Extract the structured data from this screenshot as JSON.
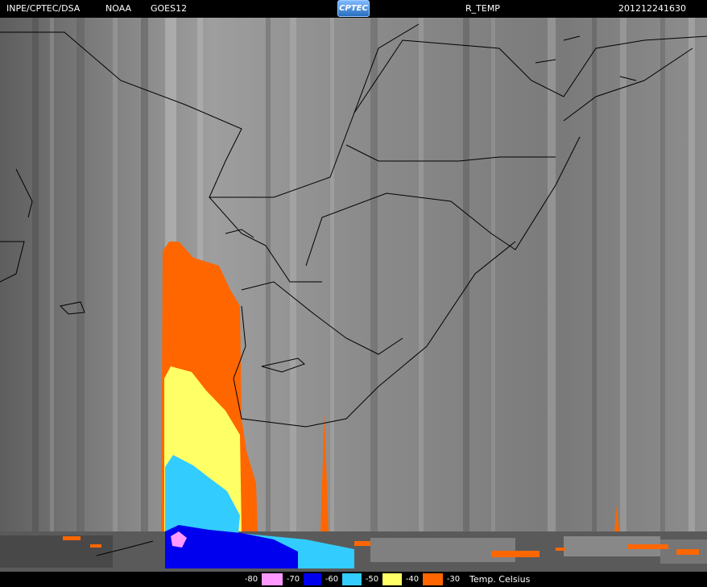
{
  "header": {
    "agency": "INPE/CPTEC/DSA",
    "noaa": "NOAA",
    "satellite": "GOES12",
    "logo_text": "CPTEC",
    "product": "R_TEMP",
    "timestamp": "201212241630"
  },
  "legend": {
    "items": [
      {
        "label": "-80",
        "color": "#000000"
      },
      {
        "label": "-70",
        "color": "#ff99ff"
      },
      {
        "label": "-60",
        "color": "#0000ee"
      },
      {
        "label": "-50",
        "color": "#33ccff"
      },
      {
        "label": "-40",
        "color": "#ffff66"
      },
      {
        "label": "-30",
        "color": "#ff6600"
      }
    ],
    "unit": "Temp. Celsius"
  }
}
